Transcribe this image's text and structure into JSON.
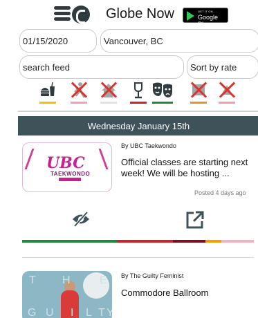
{
  "header": {
    "app_title": "Globe Now",
    "store_badge_small": "GET IT ON",
    "store_badge_big": "Google Play",
    "menu_icon": "hamburger-menu-icon",
    "logo_icon": "globe-now-logo-icon"
  },
  "filters": {
    "date_value": "01/15/2020",
    "city_value": "Vancouver, BC",
    "search_placeholder": "search feed",
    "search_value": "",
    "sort_value": "Sort by rate"
  },
  "categories": [
    {
      "name": "food-drink",
      "icon": "burger-cup-icon",
      "active": true,
      "bar_color": "#f2c200"
    },
    {
      "name": "sports",
      "icon": "running-icon",
      "active": false,
      "bar_color": "#f2a0ad"
    },
    {
      "name": "community",
      "icon": "house-icon",
      "active": false,
      "bar_color": "#e2e2e2"
    },
    {
      "name": "nightlife",
      "icon": "wine-glass-icon",
      "active": true,
      "bar_color": "#cc2229"
    },
    {
      "name": "arts",
      "icon": "theater-masks-icon",
      "active": true,
      "bar_color": "#1f8a3a"
    },
    {
      "name": "music",
      "icon": "music-icon",
      "active": false,
      "bar_color": "#e59a1c"
    },
    {
      "name": "other",
      "icon": "other-icon",
      "active": false,
      "bar_color": "#f2a0ad"
    }
  ],
  "feed": {
    "date_header": "Wednesday January 15th",
    "cards": [
      {
        "thumb_title": "UBC",
        "thumb_subtitle": "TAEKWONDO",
        "byline": "By UBC Taekwondo",
        "text": "Official classes are starting next week! We will be hosting ...",
        "posted": "Posted 4 days ago",
        "hide_icon": "eye-slash-icon",
        "share_icon": "external-link-icon",
        "rating_segments": [
          {
            "color": "#1f8a3a",
            "fraction": 0.41
          },
          {
            "color": "#cc2229",
            "fraction": 0.24
          },
          {
            "color": "#7a1020",
            "fraction": 0.14
          },
          {
            "color": "#f2a000",
            "fraction": 0.07
          },
          {
            "color": "#f5b4bf",
            "fraction": 0.14
          }
        ]
      },
      {
        "thumb_letters": [
          "T",
          "H",
          "E",
          "G",
          "U",
          "I",
          "L",
          "T",
          "Y"
        ],
        "byline": "By The Guilty Feminist",
        "text": "Commodore Ballroom"
      }
    ]
  }
}
